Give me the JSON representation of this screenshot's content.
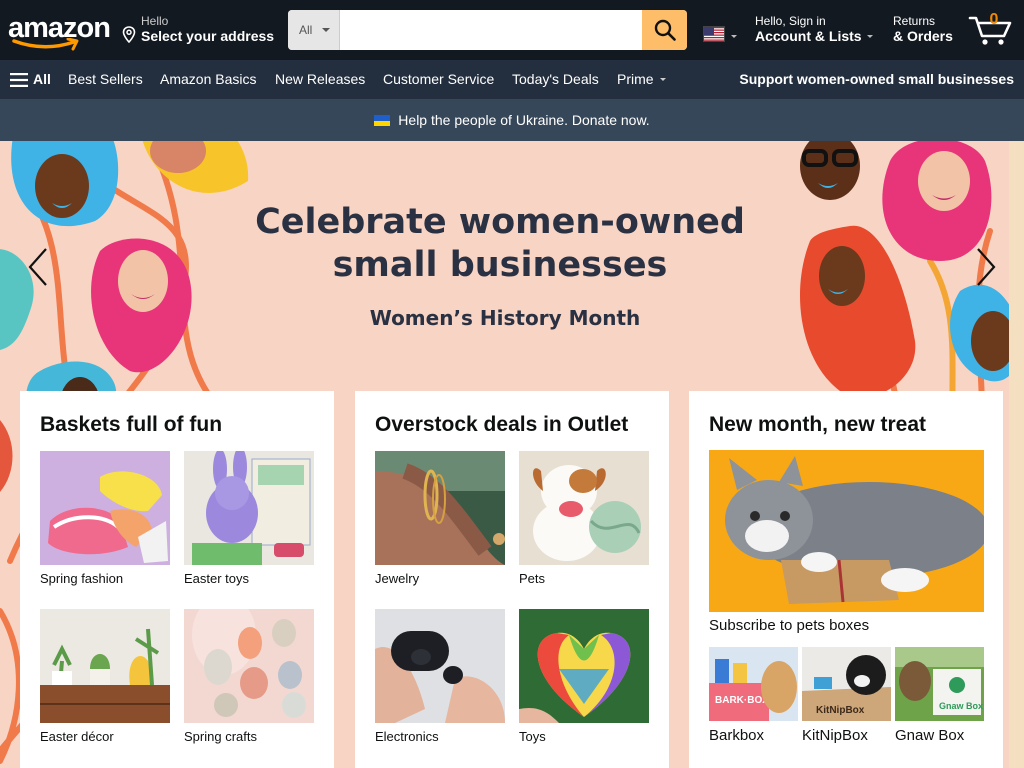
{
  "header": {
    "logo_text": "amazon",
    "address": {
      "line1": "Hello",
      "line2": "Select your address"
    },
    "search": {
      "category": "All",
      "placeholder": "",
      "value": ""
    },
    "language_flag": "us-flag-icon",
    "account": {
      "line1": "Hello, Sign in",
      "line2": "Account & Lists"
    },
    "orders": {
      "line1": "Returns",
      "line2": "& Orders"
    },
    "cart": {
      "count": "0"
    },
    "colors": {
      "nav_bg": "#131921",
      "subnav_bg": "#232f3e",
      "search_button": "#febd69",
      "cart_count": "#f08804"
    }
  },
  "subnav": {
    "all": "All",
    "items": [
      "Best Sellers",
      "Amazon Basics",
      "New Releases",
      "Customer Service",
      "Today's Deals",
      "Prime"
    ],
    "promo": "Support women-owned small businesses"
  },
  "banner": {
    "text": "Help the people of Ukraine. Donate now."
  },
  "hero": {
    "headline_line1": "Celebrate women-owned",
    "headline_line2": "small businesses",
    "subheadline": "Women’s History Month"
  },
  "cards": [
    {
      "title": "Baskets full of fun",
      "tiles": [
        {
          "label": "Spring fashion"
        },
        {
          "label": "Easter toys"
        },
        {
          "label": "Easter décor"
        },
        {
          "label": "Spring crafts"
        }
      ]
    },
    {
      "title": "Overstock deals in Outlet",
      "tiles": [
        {
          "label": "Jewelry"
        },
        {
          "label": "Pets"
        },
        {
          "label": "Electronics"
        },
        {
          "label": "Toys"
        }
      ]
    },
    {
      "title": "New month, new treat",
      "main_caption": "Subscribe to pets boxes",
      "tiles": [
        {
          "label": "Barkbox",
          "image_text": "BARK·BOX"
        },
        {
          "label": "KitNipBox",
          "image_text": "KitNipBox"
        },
        {
          "label": "Gnaw Box",
          "image_text": "Gnaw Box"
        }
      ]
    }
  ]
}
